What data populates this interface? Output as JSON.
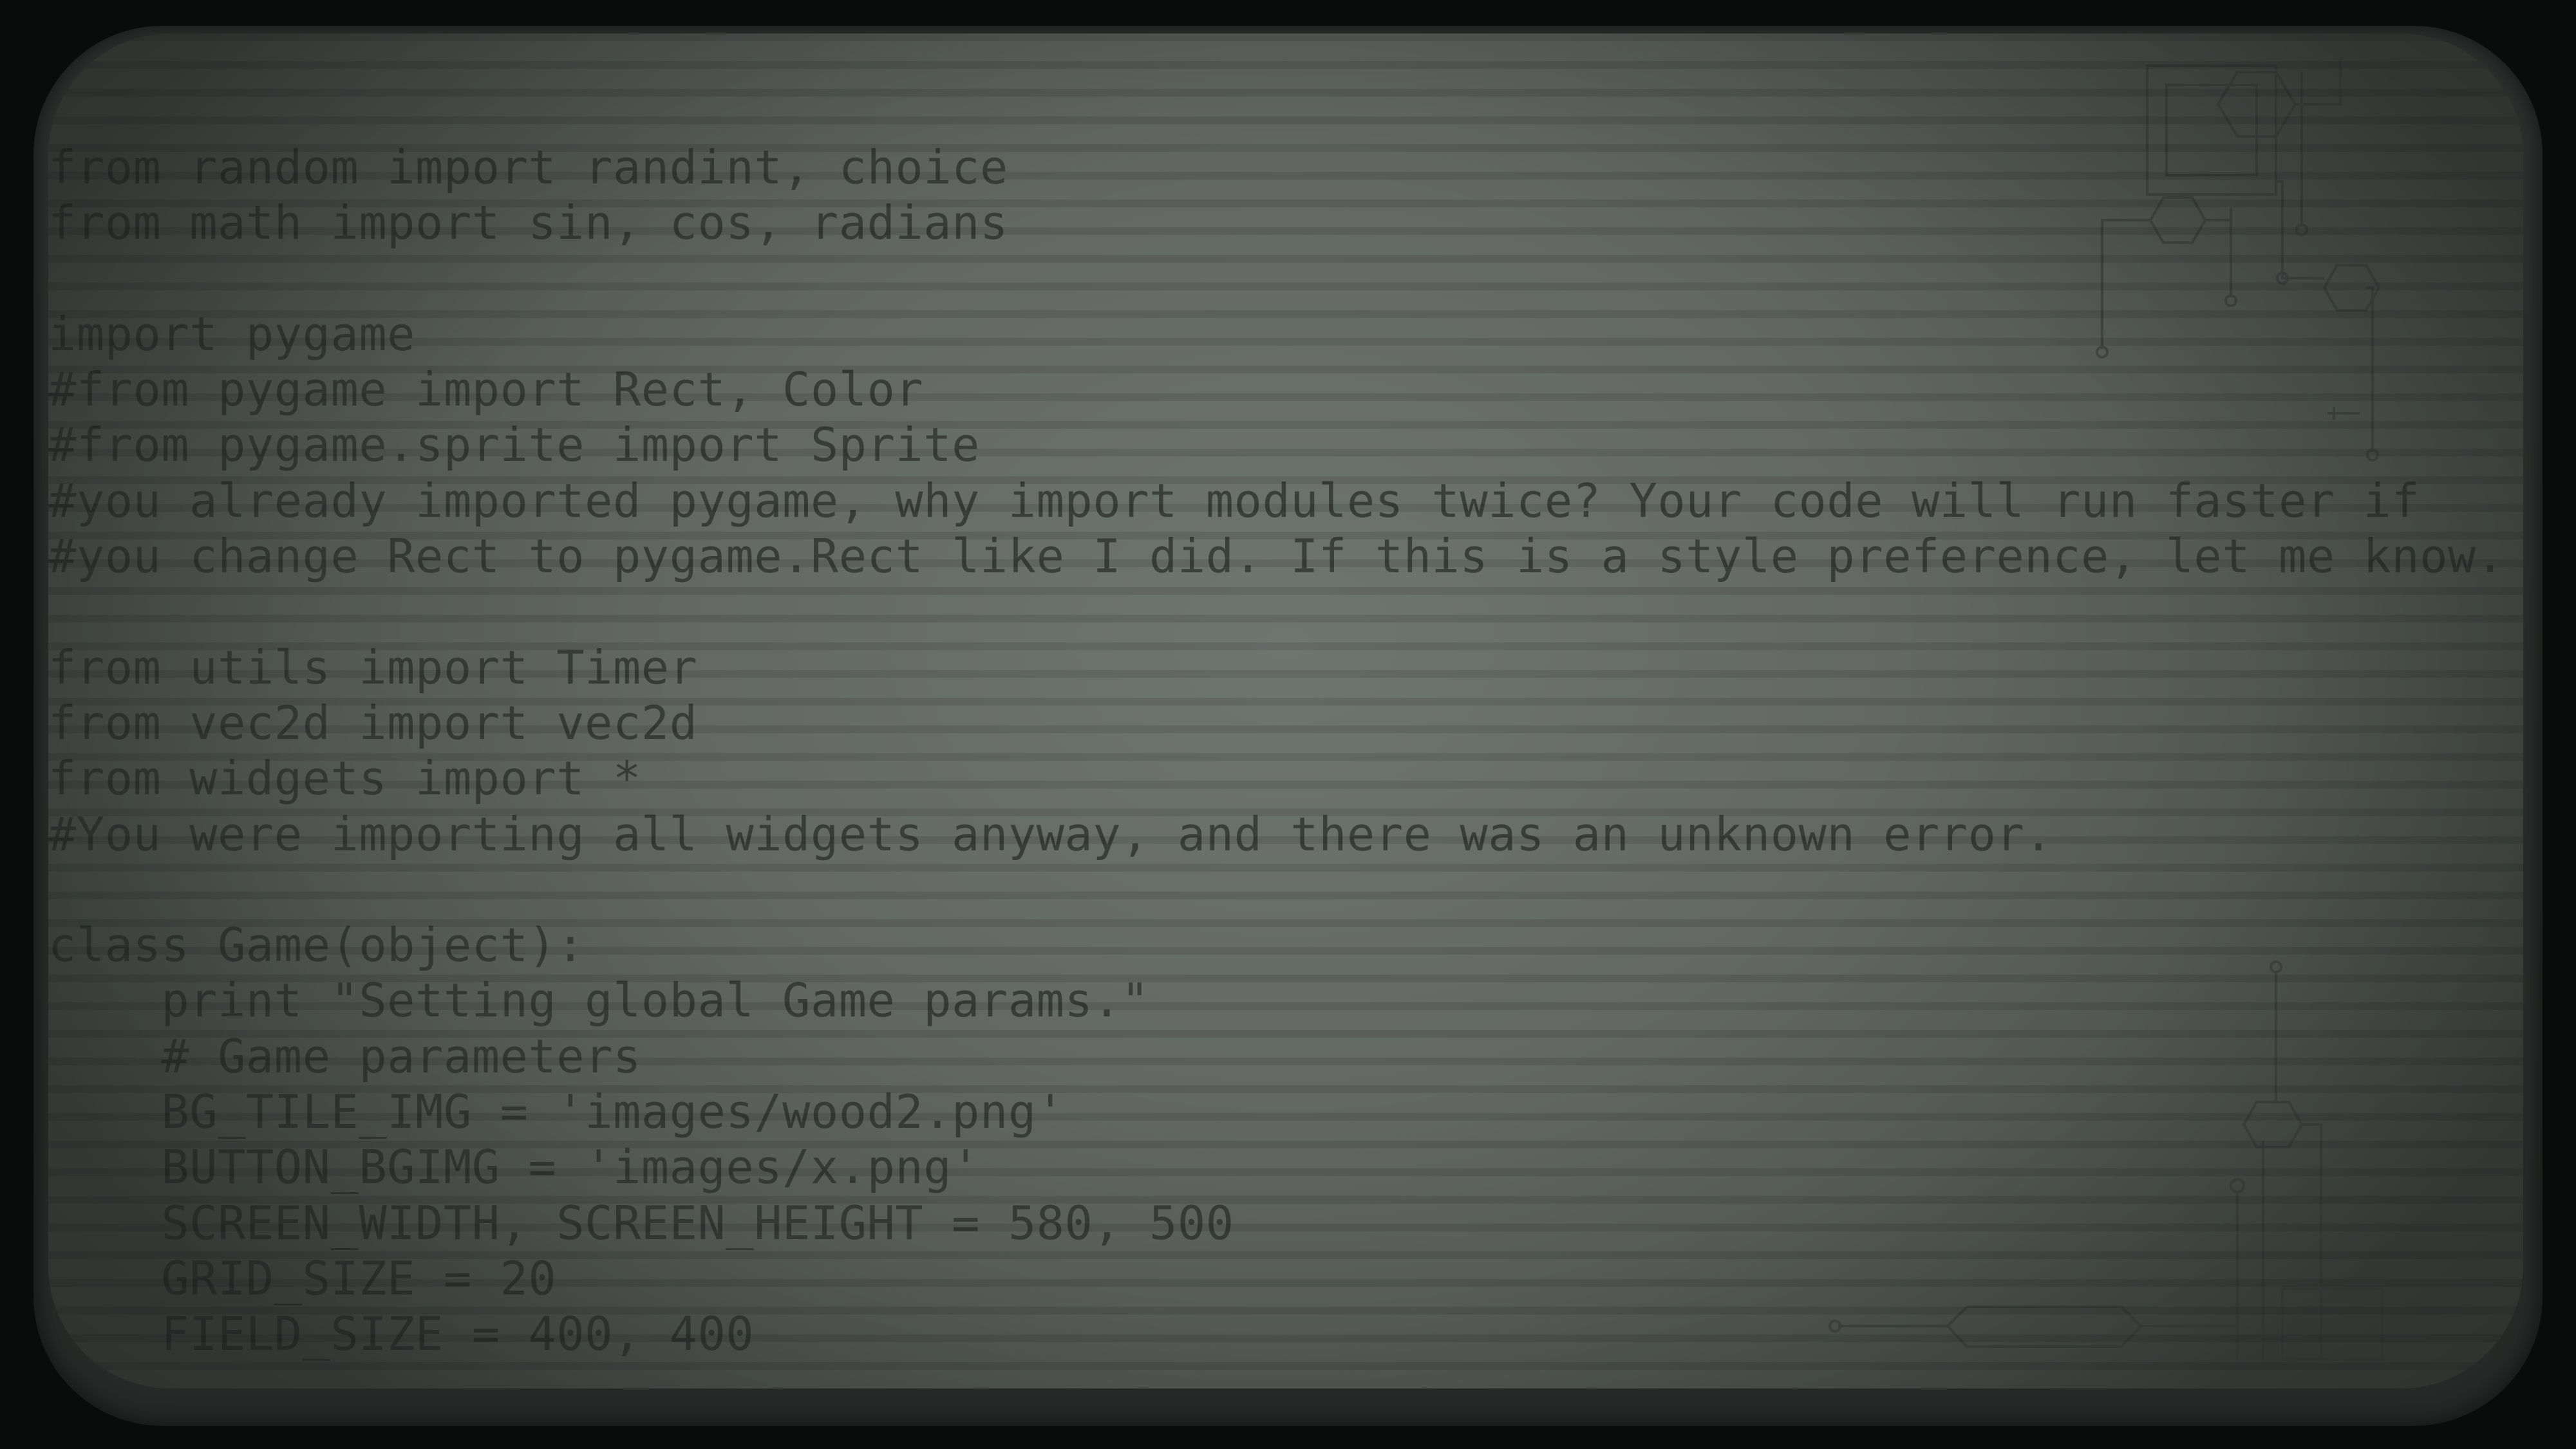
{
  "code_lines": [
    "from random import randint, choice",
    "from math import sin, cos, radians",
    "",
    "import pygame",
    "#from pygame import Rect, Color",
    "#from pygame.sprite import Sprite",
    "#you already imported pygame, why import modules twice? Your code will run faster if",
    "#you change Rect to pygame.Rect like I did. If this is a style preference, let me know.",
    "",
    "from utils import Timer",
    "from vec2d import vec2d",
    "from widgets import *",
    "#You were importing all widgets anyway, and there was an unknown error.",
    "",
    "class Game(object):",
    "    print \"Setting global Game params.\"",
    "    # Game parameters",
    "    BG_TILE_IMG = 'images/wood2.png'",
    "    BUTTON_BGIMG = 'images/x.png'",
    "    SCREEN_WIDTH, SCREEN_HEIGHT = 580, 500",
    "    GRID_SIZE = 20",
    "    FIELD_SIZE = 400, 400"
  ],
  "colors": {
    "screen": "#636864",
    "bezel": "#2b2e2c",
    "text": "#2c302e",
    "circuit": "#3a3f3c"
  }
}
